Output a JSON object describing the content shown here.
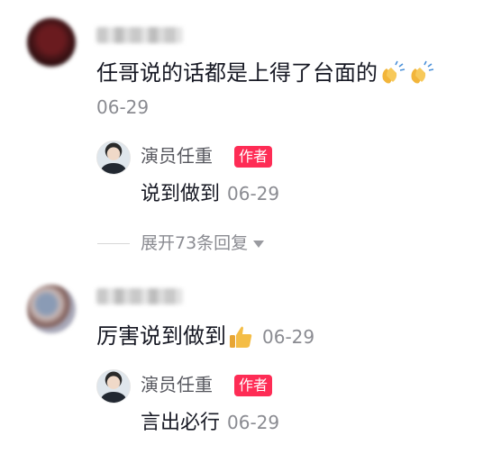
{
  "comments": [
    {
      "text": "任哥说的话都是上得了台面的",
      "emoji": [
        "clapping-hands",
        "clapping-hands"
      ],
      "date": "06-29",
      "reply": {
        "author": "演员任重",
        "badge": "作者",
        "text": "说到做到",
        "date": "06-29"
      },
      "expand_label": "展开73条回复"
    },
    {
      "text": "厉害说到做到",
      "emoji": [
        "thumbs-up"
      ],
      "date": "06-29",
      "reply": {
        "author": "演员任重",
        "badge": "作者",
        "text": "言出必行",
        "date": "06-29"
      }
    }
  ],
  "colors": {
    "badge": "#fe2c55",
    "meta": "#8a8b91"
  }
}
